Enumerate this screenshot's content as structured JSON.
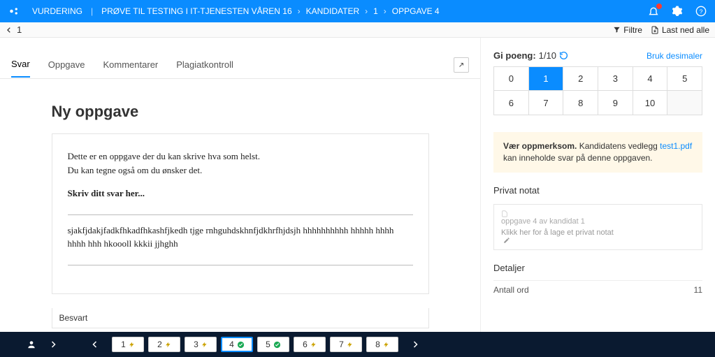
{
  "breadcrumb": {
    "root": "VURDERING",
    "items": [
      "PRØVE TIL TESTING I IT-TJENESTEN VÅREN 16",
      "KANDIDATER",
      "1",
      "OPPGAVE 4"
    ]
  },
  "subbar": {
    "current": "1",
    "filter": "Filtre",
    "download": "Last ned alle"
  },
  "tabs": {
    "svar": "Svar",
    "oppgave": "Oppgave",
    "kommentarer": "Kommentarer",
    "plagiat": "Plagiatkontroll"
  },
  "content": {
    "title": "Ny oppgave",
    "line1": "Dette er en oppgave der du kan skrive hva som helst.",
    "line2": "Du kan tegne også om du ønsker det.",
    "prompt": "Skriv ditt svar her...",
    "answer1": "sjakfjdakjfadkfhkadfhkashfjkedh tjge rnhguhdskhnfjdkhrfhjdsjh hhhhhhhhhh hhhhh hhhh",
    "answer2": "hhhh hhh hkoooll kkkii jjhghh",
    "status": "Besvart"
  },
  "score": {
    "label": "Gi poeng:",
    "current": "1/10",
    "decimals": "Bruk desimaler",
    "cells_row1": [
      "0",
      "1",
      "2",
      "3",
      "4",
      "5"
    ],
    "cells_row2": [
      "6",
      "7",
      "8",
      "9",
      "10",
      ""
    ],
    "selected": "1"
  },
  "alert": {
    "strong": "Vær oppmerksom.",
    "text1": " Kandidatens vedlegg ",
    "link": "test1.pdf",
    "text2": " kan inneholde svar på denne oppgaven."
  },
  "notes": {
    "heading": "Privat notat",
    "line1": "oppgave 4 av kandidat 1",
    "line2": "Klikk her for å lage et privat notat"
  },
  "details": {
    "heading": "Detaljer",
    "words_label": "Antall ord",
    "words_value": "11"
  },
  "bottombar": {
    "questions": [
      {
        "n": "1",
        "icon": "bolt",
        "active": false
      },
      {
        "n": "2",
        "icon": "bolt",
        "active": false
      },
      {
        "n": "3",
        "icon": "bolt",
        "active": false
      },
      {
        "n": "4",
        "icon": "check",
        "active": true
      },
      {
        "n": "5",
        "icon": "check",
        "active": false
      },
      {
        "n": "6",
        "icon": "bolt",
        "active": false
      },
      {
        "n": "7",
        "icon": "bolt",
        "active": false
      },
      {
        "n": "8",
        "icon": "bolt",
        "active": false
      }
    ]
  }
}
